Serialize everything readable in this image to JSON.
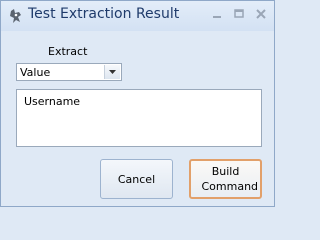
{
  "window": {
    "title": "Test Extraction Result"
  },
  "extract": {
    "label": "Extract",
    "selected": "Value"
  },
  "result": {
    "value": "Username"
  },
  "buttons": {
    "cancel": "Cancel",
    "build": "Build Command"
  },
  "icons": [
    "app-icon",
    "minimize-icon",
    "maximize-icon",
    "close-icon",
    "chevron-down-icon"
  ]
}
